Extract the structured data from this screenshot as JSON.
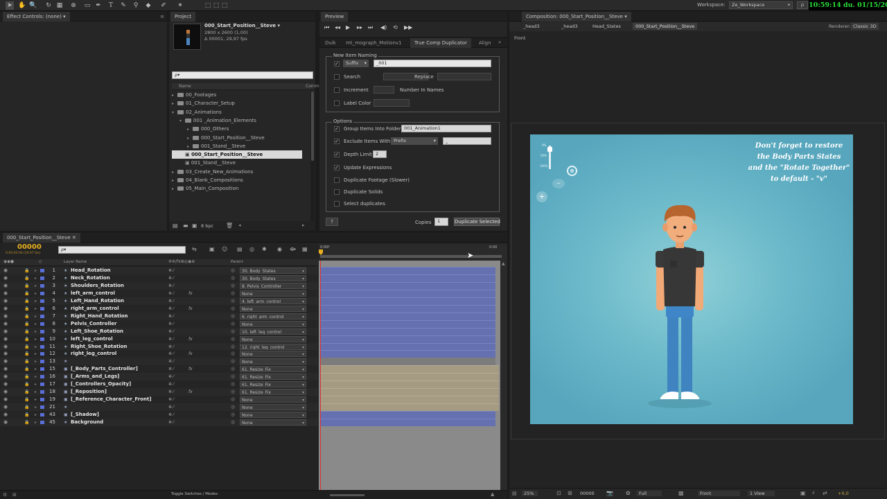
{
  "workspace": {
    "label": "Workspace:",
    "value": "Ze_Workspace",
    "clock": "10:59:14 du. 01/15/2016"
  },
  "effect_controls": {
    "tab": "Effect Controls: (none)"
  },
  "project": {
    "tab": "Project",
    "selected_item": {
      "name": "000_Start_Position__Steve ▾",
      "size": "2800 x 2600 (1,00)",
      "duration": "Δ 00001, 29,97 fps"
    },
    "search_placeholder": "ρ▾",
    "col_name": "Name",
    "col_comment": "Comm",
    "tree": [
      {
        "label": "00_Footages",
        "indent": 0,
        "tri": "▸",
        "kind": "folder"
      },
      {
        "label": "01_Character_Setup",
        "indent": 0,
        "tri": "▸",
        "kind": "folder"
      },
      {
        "label": "02_Animations",
        "indent": 0,
        "tri": "▾",
        "kind": "folder"
      },
      {
        "label": "001 _Animation_Elements",
        "indent": 1,
        "tri": "▾",
        "kind": "folder"
      },
      {
        "label": "000_Others",
        "indent": 2,
        "tri": "▸",
        "kind": "folder"
      },
      {
        "label": "000_Start_Position__Steve",
        "indent": 2,
        "tri": "▸",
        "kind": "folder"
      },
      {
        "label": "001_Stand__Steve",
        "indent": 2,
        "tri": "▸",
        "kind": "folder"
      },
      {
        "label": "000_Start_Position__Steve",
        "indent": 1,
        "tri": "",
        "kind": "comp",
        "selected": true
      },
      {
        "label": "001_Stand__Steve",
        "indent": 1,
        "tri": "",
        "kind": "comp"
      },
      {
        "label": "03_Create_New_Animations",
        "indent": 0,
        "tri": "▸",
        "kind": "folder"
      },
      {
        "label": "04_Blank_Compositions",
        "indent": 0,
        "tri": "▸",
        "kind": "folder"
      },
      {
        "label": "05_Main_Composition",
        "indent": 0,
        "tri": "▸",
        "kind": "folder"
      }
    ],
    "bpc": "8 bpc"
  },
  "preview": {
    "tab": "Preview"
  },
  "plugin": {
    "tabs": [
      "Duik",
      "mt_mograph_Motionv1",
      "True Comp Duplicator",
      "Align"
    ],
    "naming": {
      "title": "New Item Naming",
      "suffix_label": "Suffix",
      "suffix_value": "_001",
      "search_label": "Search",
      "replace_label": "Replace",
      "increment_label": "Increment",
      "number_in_names_label": "Number In Names",
      "label_color_label": "Label Color"
    },
    "options": {
      "title": "Options",
      "group_label": "Group Items Into Folder",
      "group_value": "001_Animation1",
      "exclude_label": "Exclude Items With",
      "exclude_mode": "Prefix",
      "exclude_value": "_",
      "depth_label": "Depth Limit",
      "depth_value": "2",
      "update_expr_label": "Update Expressions",
      "dup_footage_label": "Duplicate Footage (Slower)",
      "dup_solids_label": "Duplicate Solids",
      "select_dups_label": "Select duplicates"
    },
    "help_label": "?",
    "copies_label": "Copies",
    "copies_value": "1",
    "duplicate_button": "Duplicate Selected"
  },
  "composition": {
    "tab": "Composition: 000_Start_Position__Steve",
    "breadcrumbs": [
      "_head3",
      "_head3",
      "Head_States",
      "000_Start_Position__Steve"
    ],
    "renderer_label": "Renderer:",
    "renderer_value": "Classic 3D",
    "view_label": "Front",
    "slider_ticks": [
      "0%",
      "50%",
      "100%"
    ],
    "note_lines": [
      "Don't forget to restore",
      "the Body Parts States",
      "and the \"Rotate Together\"",
      "to default - \"v\""
    ],
    "footer": {
      "zoom": "25%",
      "timecode": "00000",
      "quality": "Full",
      "view": "Front",
      "views": "1 View",
      "exposure": "+0,0"
    }
  },
  "timeline": {
    "tab": "000_Start_Position__Steve",
    "timecode": "00000",
    "timecode_sub": "0:00:00:00 (29,97 fps)",
    "search_placeholder": "ρ▾",
    "col_layer_name": "Layer Name",
    "col_parent": "Parent",
    "ruler_start": "0:00f",
    "ruler_end": "0:00",
    "toggle_label": "Toggle Switches / Modes",
    "layers": [
      {
        "num": "1",
        "name": "Head_Rotation",
        "parent": "30. Body_States",
        "color": "#5b6fd8",
        "bar": "blue",
        "type": "★",
        "fx": ""
      },
      {
        "num": "2",
        "name": "Neck_Rotation",
        "parent": "30. Body_States",
        "color": "#5b6fd8",
        "bar": "blue",
        "type": "★",
        "fx": ""
      },
      {
        "num": "3",
        "name": "Shoulders_Rotation",
        "parent": "8. Pelvis_Controller",
        "color": "#5b6fd8",
        "bar": "blue",
        "type": "★",
        "fx": ""
      },
      {
        "num": "4",
        "name": "left_arm_control",
        "parent": "None",
        "color": "#5b6fd8",
        "bar": "blue",
        "type": "★",
        "fx": "fx"
      },
      {
        "num": "5",
        "name": "Left_Hand_Rotation",
        "parent": "4. left_arm_control",
        "color": "#5b6fd8",
        "bar": "blue",
        "type": "★",
        "fx": ""
      },
      {
        "num": "6",
        "name": "right_arm_control",
        "parent": "None",
        "color": "#5b6fd8",
        "bar": "blue",
        "type": "★",
        "fx": "fx"
      },
      {
        "num": "7",
        "name": "Right_Hand_Rotation",
        "parent": "6. right_arm_control",
        "color": "#5b6fd8",
        "bar": "blue",
        "type": "★",
        "fx": ""
      },
      {
        "num": "8",
        "name": "Pelvis_Controller",
        "parent": "None",
        "color": "#5b6fd8",
        "bar": "blue",
        "type": "★",
        "fx": ""
      },
      {
        "num": "9",
        "name": "Left_Shoe_Rotation",
        "parent": "10. left_leg_control",
        "color": "#5b6fd8",
        "bar": "blue",
        "type": "★",
        "fx": ""
      },
      {
        "num": "10",
        "name": "left_leg_control",
        "parent": "None",
        "color": "#5b6fd8",
        "bar": "blue",
        "type": "★",
        "fx": "fx"
      },
      {
        "num": "11",
        "name": "Right_Shoe_Rotation",
        "parent": "12. right_leg_control",
        "color": "#5b6fd8",
        "bar": "blue",
        "type": "★",
        "fx": ""
      },
      {
        "num": "12",
        "name": "right_leg_control",
        "parent": "None",
        "color": "#5b6fd8",
        "bar": "blue",
        "type": "★",
        "fx": "fx"
      },
      {
        "num": "13",
        "name": "",
        "parent": "None",
        "color": "#5b6fd8",
        "bar": "none",
        "type": "★",
        "fx": ""
      },
      {
        "num": "15",
        "name": "[_Body_Parts_Controller]",
        "parent": "61. Resize_Fix",
        "color": "#5b6fd8",
        "bar": "tan",
        "type": "▣",
        "fx": "fx"
      },
      {
        "num": "16",
        "name": "[_Arms_and_Legs]",
        "parent": "61. Resize_Fix",
        "color": "#5b6fd8",
        "bar": "tan",
        "type": "▣",
        "fx": ""
      },
      {
        "num": "17",
        "name": "[_Controllers_Opacity]",
        "parent": "61. Resize_Fix",
        "color": "#5b6fd8",
        "bar": "tan",
        "type": "▣",
        "fx": ""
      },
      {
        "num": "18",
        "name": "[_Reposition]",
        "parent": "61. Resize_Fix",
        "color": "#5b6fd8",
        "bar": "tan",
        "type": "▣",
        "fx": "fx"
      },
      {
        "num": "19",
        "name": "[_Reference_Character_Front]",
        "parent": "None",
        "color": "#5b6fd8",
        "bar": "tan",
        "type": "▣",
        "fx": ""
      },
      {
        "num": "21",
        "name": "",
        "parent": "None",
        "color": "#5b6fd8",
        "bar": "tan",
        "type": "★",
        "fx": ""
      },
      {
        "num": "43",
        "name": "[_Shadow]",
        "parent": "None",
        "color": "#5b6fd8",
        "bar": "blue",
        "type": "▣",
        "fx": ""
      },
      {
        "num": "45",
        "name": "Background",
        "parent": "None",
        "color": "#5b6fd8",
        "bar": "blue",
        "type": "★",
        "fx": ""
      }
    ]
  }
}
